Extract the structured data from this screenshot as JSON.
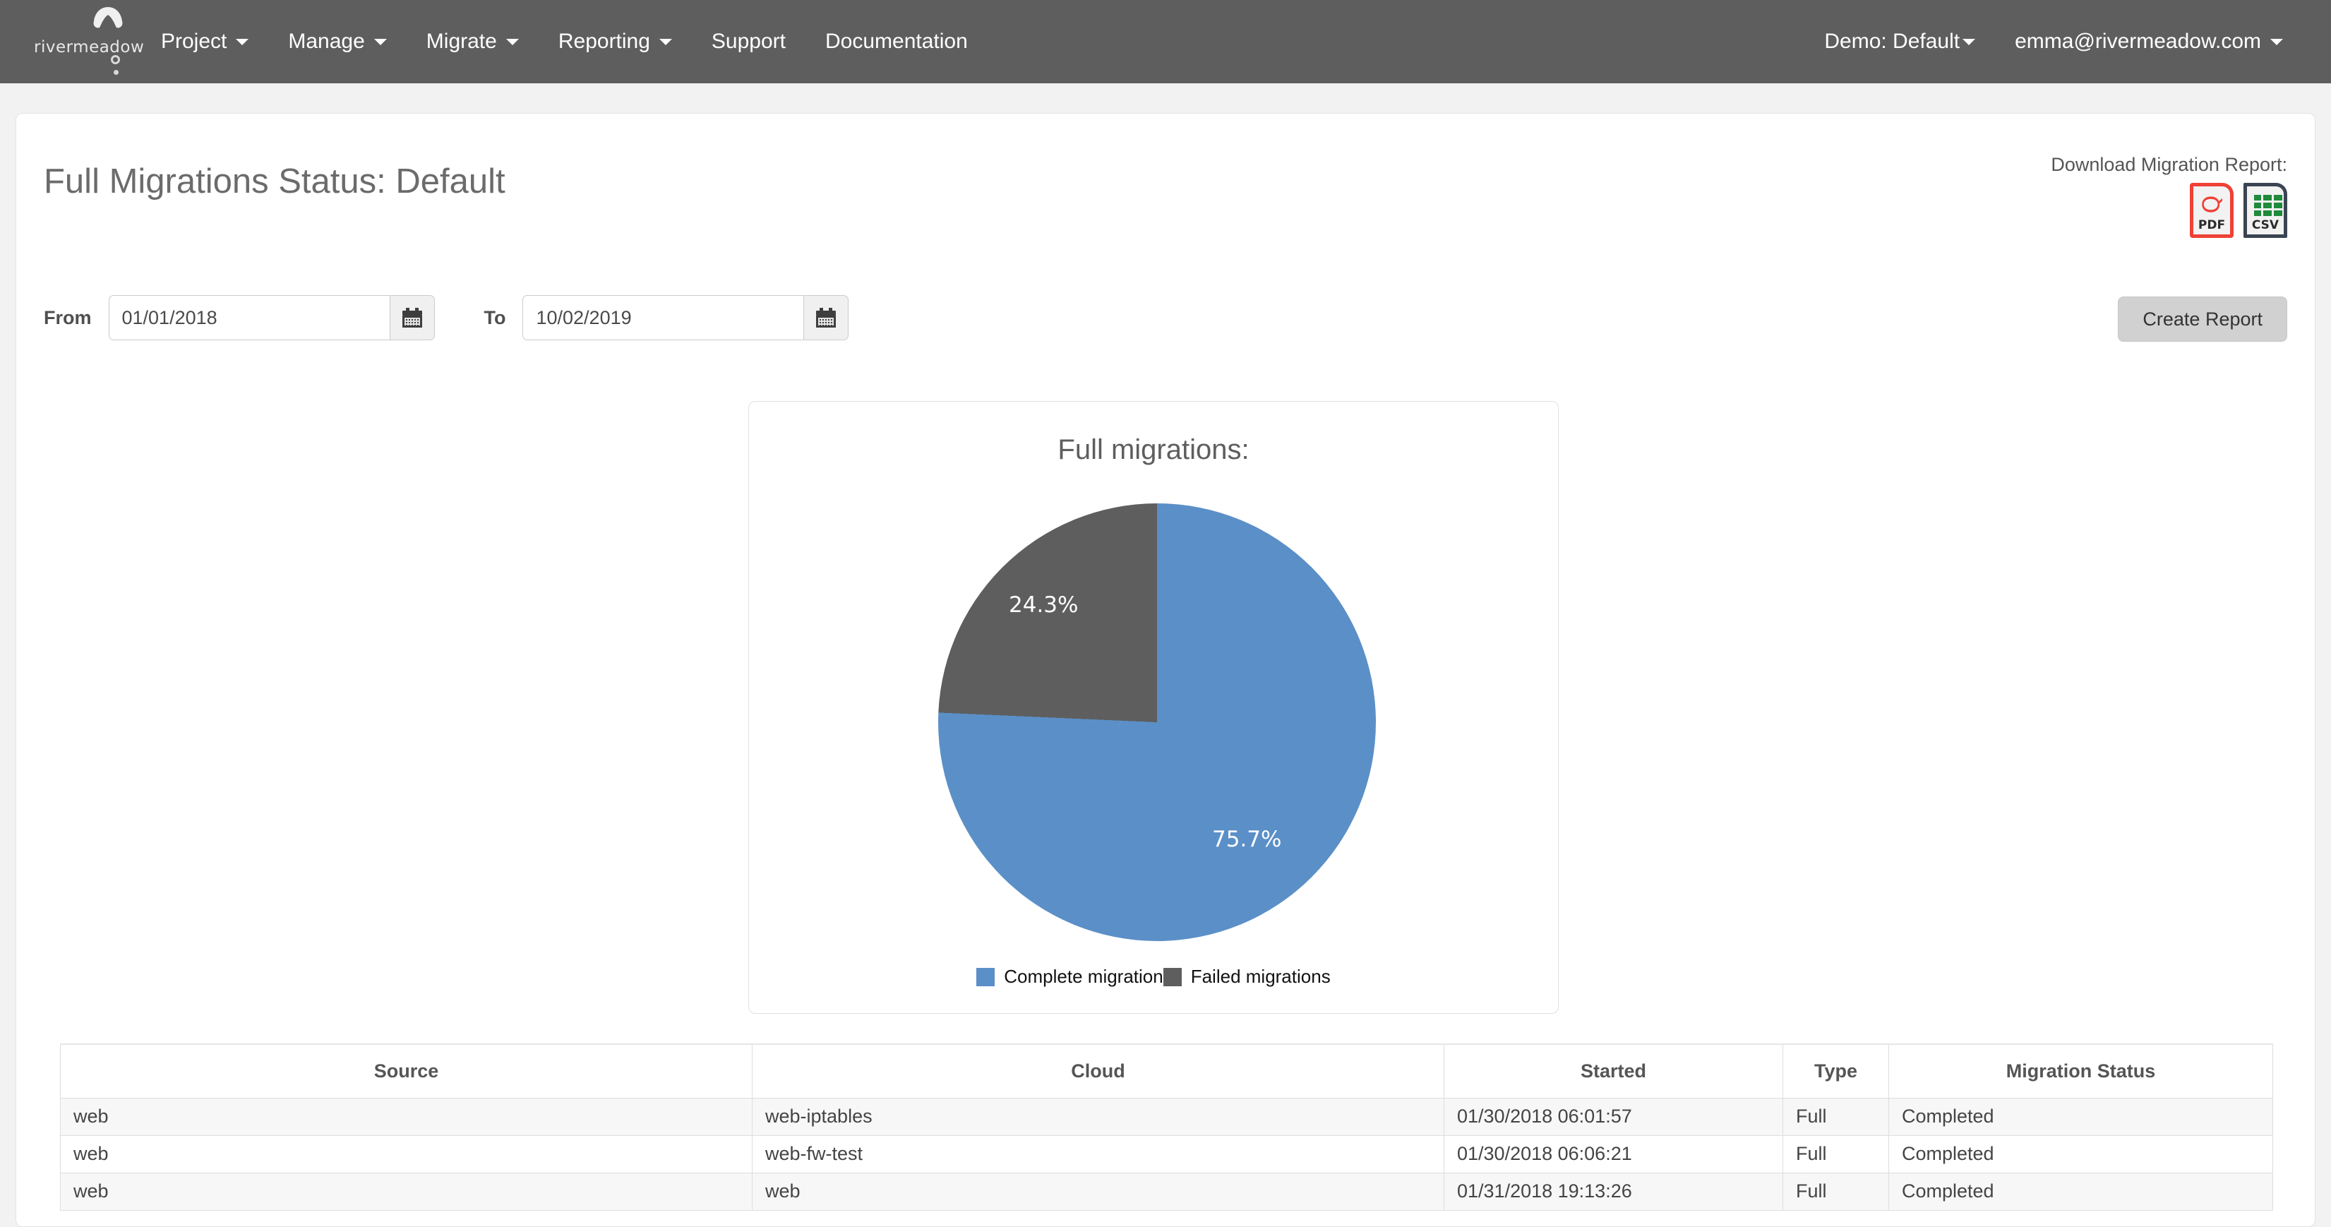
{
  "navbar": {
    "brand": {
      "word": "rivermeadow",
      "icon": "cloud-icon"
    },
    "items": [
      {
        "label": "Project",
        "caret": true
      },
      {
        "label": "Manage",
        "caret": true
      },
      {
        "label": "Migrate",
        "caret": true
      },
      {
        "label": "Reporting",
        "caret": true
      },
      {
        "label": "Support",
        "caret": false
      },
      {
        "label": "Documentation",
        "caret": false
      }
    ],
    "right": [
      {
        "label": "Demo: Default",
        "caret": true
      },
      {
        "label": "emma@rivermeadow.com",
        "caret": true
      }
    ]
  },
  "page": {
    "title": "Full Migrations Status: Default"
  },
  "download": {
    "label": "Download Migration Report:",
    "pdf": {
      "type": "PDF",
      "icon": "pdf-file-icon",
      "color": "#ef4136"
    },
    "csv": {
      "type": "CSV",
      "icon": "csv-file-icon",
      "color": "#3a4452"
    }
  },
  "filters": {
    "from_label": "From",
    "from_value": "01/01/2018",
    "from_placeholder": "mm/dd/yyyy",
    "to_label": "To",
    "to_value": "10/02/2019",
    "to_placeholder": "mm/dd/yyyy",
    "calendar_icon": "calendar-icon",
    "create_report": "Create Report"
  },
  "chart_data": {
    "type": "pie",
    "title": "Full migrations:",
    "categories": [
      "Complete migration",
      "Failed migrations"
    ],
    "values": [
      75.7,
      24.3
    ],
    "labels": [
      "75.7%",
      "24.3%"
    ],
    "colors": [
      "#5b8fc7",
      "#5e5e5e"
    ],
    "legend_position": "bottom",
    "start_angle_deg": 0,
    "direction": "clockwise",
    "xlabel": "",
    "ylabel": ""
  },
  "table": {
    "columns": [
      "Source",
      "Cloud",
      "Started",
      "Type",
      "Migration Status"
    ],
    "rows": [
      {
        "source": "web",
        "cloud": "web-iptables",
        "started": "01/30/2018 06:01:57",
        "type": "Full",
        "status": "Completed"
      },
      {
        "source": "web",
        "cloud": "web-fw-test",
        "started": "01/30/2018 06:06:21",
        "type": "Full",
        "status": "Completed"
      },
      {
        "source": "web",
        "cloud": "web",
        "started": "01/31/2018 19:13:26",
        "type": "Full",
        "status": "Completed"
      }
    ]
  }
}
